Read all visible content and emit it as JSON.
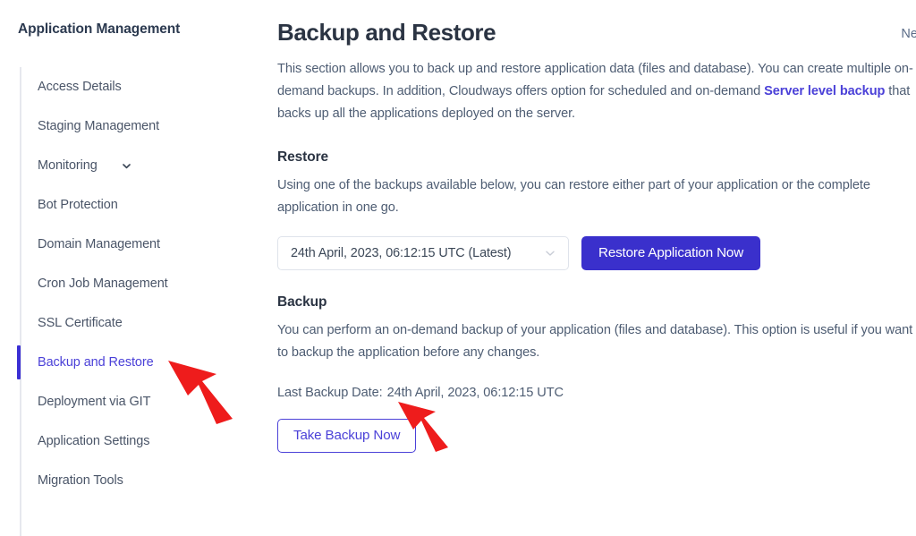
{
  "sidebar": {
    "title": "Application Management",
    "items": [
      {
        "label": "Access Details",
        "active": false,
        "chevron": false
      },
      {
        "label": "Staging Management",
        "active": false,
        "chevron": false
      },
      {
        "label": "Monitoring",
        "active": false,
        "chevron": true
      },
      {
        "label": "Bot Protection",
        "active": false,
        "chevron": false
      },
      {
        "label": "Domain Management",
        "active": false,
        "chevron": false
      },
      {
        "label": "Cron Job Management",
        "active": false,
        "chevron": false
      },
      {
        "label": "SSL Certificate",
        "active": false,
        "chevron": false
      },
      {
        "label": "Backup and Restore",
        "active": true,
        "chevron": false
      },
      {
        "label": "Deployment via GIT",
        "active": false,
        "chevron": false
      },
      {
        "label": "Application Settings",
        "active": false,
        "chevron": false
      },
      {
        "label": "Migration Tools",
        "active": false,
        "chevron": false
      }
    ]
  },
  "main": {
    "title": "Backup and Restore",
    "need_help": "Nee",
    "intro_part1": "This section allows you to back up and restore application data (files and database). You can create multiple on-demand backups. In addition, Cloudways offers option for scheduled and on-demand ",
    "intro_link": "Server level backup",
    "intro_part2": " that backs up all the applications deployed on the server.",
    "restore": {
      "heading": "Restore",
      "description": "Using one of the backups available below, you can restore either part of your application or the complete application in one go.",
      "selected_backup": "24th April, 2023, 06:12:15 UTC (Latest)",
      "restore_button": "Restore Application Now"
    },
    "backup": {
      "heading": "Backup",
      "description": "You can perform an on-demand backup of your application (files and database). This option is useful if you want to backup the application before any changes.",
      "last_backup_label": "Last Backup Date:",
      "last_backup_value": "24th April, 2023, 06:12:15 UTC",
      "take_backup_button": "Take Backup Now"
    }
  },
  "colors": {
    "accent": "#4b41d8",
    "primary_button": "#3a30cc",
    "heading": "#2b3443",
    "body_text": "#4e5d73",
    "rail": "#e6e8ee",
    "annotation_arrow": "#ee1c1c"
  }
}
